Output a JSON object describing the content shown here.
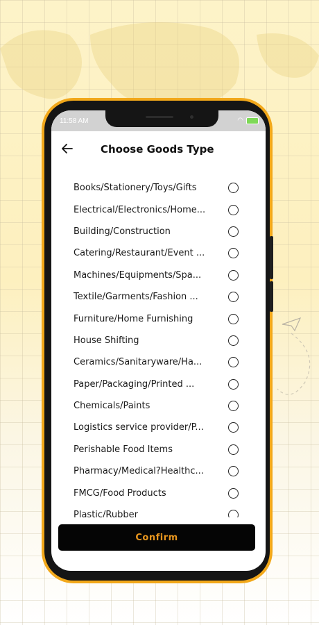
{
  "status_bar": {
    "time": "11:58 AM",
    "battery": "70"
  },
  "header": {
    "title": "Choose Goods Type",
    "back_icon": "arrow-left-icon"
  },
  "goods_types": [
    "Books/Stationery/Toys/Gifts",
    "Electrical/Electronics/Home...",
    "Building/Construction",
    "Catering/Restaurant/Event ...",
    "Machines/Equipments/Spa...",
    "Textile/Garments/Fashion ...",
    "Furniture/Home Furnishing",
    "House Shifting",
    "Ceramics/Sanitaryware/Ha...",
    "Paper/Packaging/Printed ...",
    "Chemicals/Paints",
    "Logistics service provider/P...",
    "Perishable Food Items",
    "Pharmacy/Medical?Healthc...",
    "FMCG/Food Products",
    "Plastic/Rubber"
  ],
  "confirm_button": {
    "label": "Confirm"
  },
  "colors": {
    "accent": "#f2a81a",
    "button_bg": "#050505",
    "button_text": "#e8961e"
  }
}
